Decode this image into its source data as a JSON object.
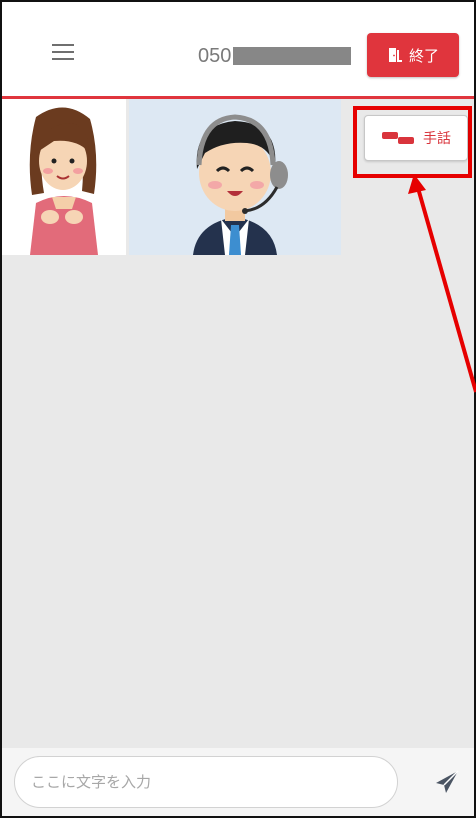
{
  "header": {
    "phone_prefix": "050",
    "end_button_label": "終了"
  },
  "sign_button": {
    "label": "手話"
  },
  "message_input": {
    "placeholder": "ここに文字を入力",
    "value": ""
  },
  "icons": {
    "menu": "hamburger-icon",
    "end": "door-exit-icon",
    "sign": "sign-language-hands-icon",
    "send": "paper-plane-icon"
  },
  "colors": {
    "accent": "#e0353d",
    "highlight": "#e60000",
    "content_background": "#e9e9e9",
    "agent_video_background": "#dde8f3"
  }
}
